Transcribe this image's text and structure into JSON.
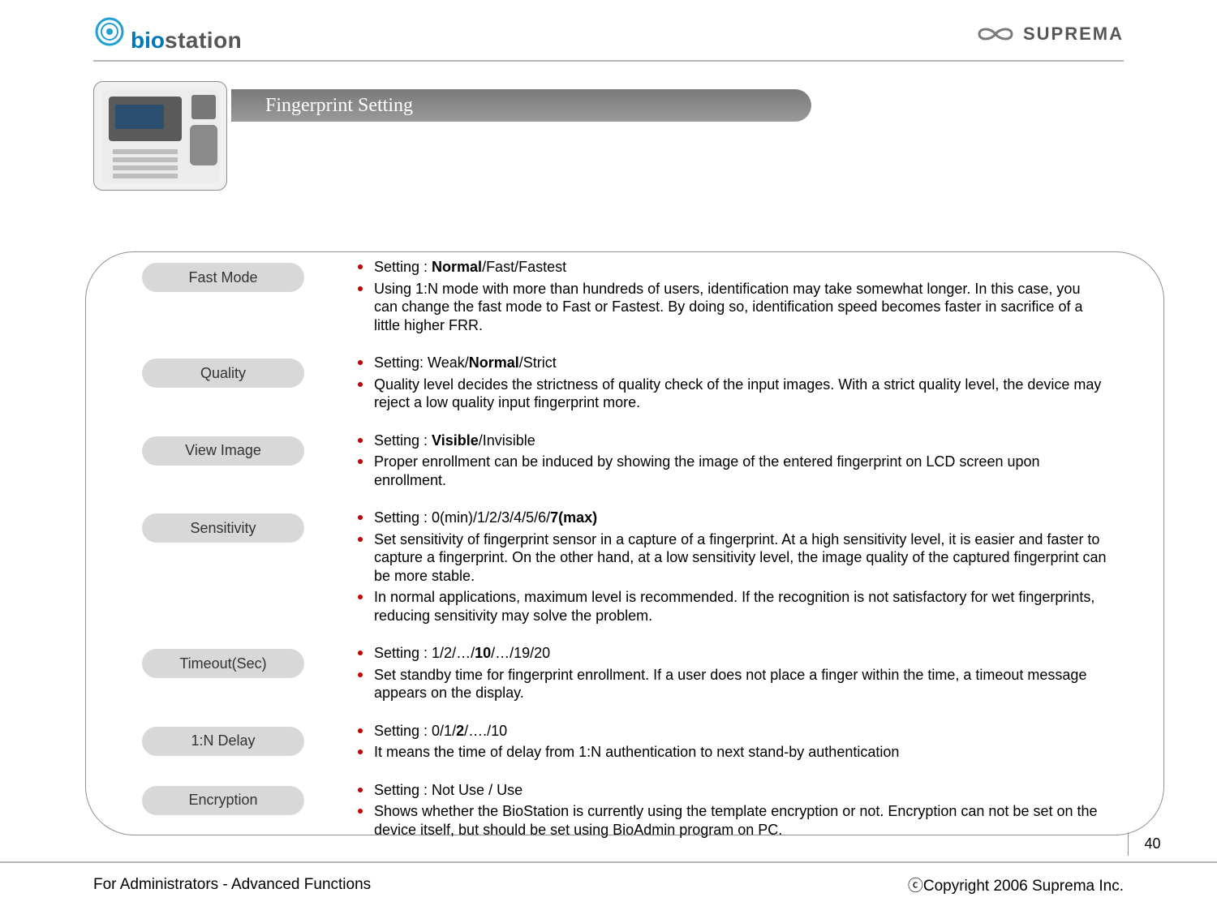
{
  "brand_left": {
    "bio": "bio",
    "station": "station"
  },
  "brand_right": "SUPREMA",
  "title": "Fingerprint Setting",
  "page_num": "40",
  "footer_left": "For Administrators - Advanced Functions",
  "footer_right": "ⓒCopyright 2006 Suprema Inc.",
  "sections": [
    {
      "label": "Fast Mode",
      "items": [
        {
          "pre": "Setting : ",
          "bold": "Normal",
          "post": "/Fast/Fastest"
        },
        {
          "plain": "Using 1:N mode with more than hundreds of users, identification may take somewhat longer. In this case, you can change the fast mode to Fast or Fastest. By doing so, identification speed becomes faster in sacrifice of a little higher FRR."
        }
      ]
    },
    {
      "label": "Quality",
      "items": [
        {
          "pre": "Setting: Weak/",
          "bold": "Normal",
          "post": "/Strict"
        },
        {
          "plain": "Quality level decides the strictness of quality check of the input images. With a strict quality level, the device may reject a low quality input fingerprint more."
        }
      ]
    },
    {
      "label": "View Image",
      "items": [
        {
          "pre": "Setting : ",
          "bold": "Visible",
          "post": "/Invisible"
        },
        {
          "plain": "Proper enrollment can be induced by showing the image of the entered fingerprint on LCD screen upon enrollment."
        }
      ]
    },
    {
      "label": "Sensitivity",
      "items": [
        {
          "pre": "Setting : 0(min)/1/2/3/4/5/6/",
          "bold": "7(max)",
          "post": ""
        },
        {
          "plain": "Set sensitivity of fingerprint sensor in a capture of a fingerprint. At a high sensitivity level, it is easier and faster to capture a fingerprint. On the other hand, at a low sensitivity level, the image quality of the captured fingerprint can be more stable."
        },
        {
          "plain": "In normal applications, maximum level is recommended. If the recognition is not satisfactory for wet fingerprints, reducing sensitivity may solve the problem."
        }
      ]
    },
    {
      "label": "Timeout(Sec)",
      "items": [
        {
          "pre": "Setting : 1/2/…/",
          "bold": "10",
          "post": "/…/19/20"
        },
        {
          "plain": "Set standby time for fingerprint enrollment. If a user does not place a finger within the time, a timeout message appears on the display."
        }
      ]
    },
    {
      "label": "1:N Delay",
      "items": [
        {
          "pre": " Setting : 0/1/",
          "bold": "2",
          "post": "/…./10"
        },
        {
          "plain": " It means the time of delay from 1:N authentication to next stand-by authentication"
        }
      ]
    },
    {
      "label": "Encryption",
      "items": [
        {
          "plain": "Setting : Not Use / Use"
        },
        {
          "plain": "Shows whether the BioStation is currently using the template encryption or not. Encryption can not be set on the device itself, but should be set using BioAdmin program on PC."
        }
      ]
    }
  ]
}
